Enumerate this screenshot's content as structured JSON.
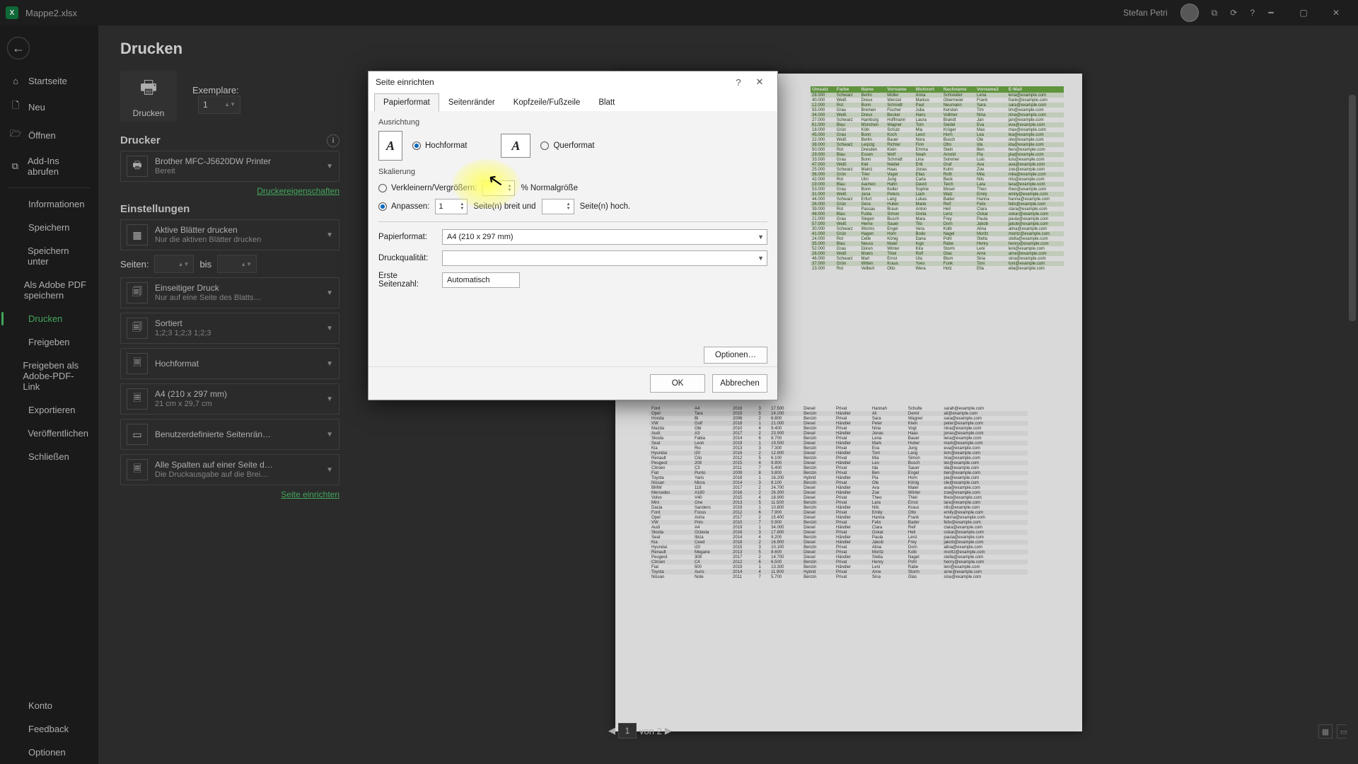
{
  "titlebar": {
    "filename": "Mappe2.xlsx",
    "username": "Stefan Petri"
  },
  "nav": {
    "items": [
      {
        "icon": "⌂",
        "label": "Startseite"
      },
      {
        "icon": "🗋",
        "label": "Neu"
      },
      {
        "icon": "🗁",
        "label": "Öffnen"
      },
      {
        "icon": "⧉",
        "label": "Add-Ins abrufen"
      },
      {
        "icon": "",
        "label": "Informationen"
      },
      {
        "icon": "",
        "label": "Speichern"
      },
      {
        "icon": "",
        "label": "Speichern unter"
      },
      {
        "icon": "",
        "label": "Als Adobe PDF speichern"
      },
      {
        "icon": "",
        "label": "Drucken",
        "active": true
      },
      {
        "icon": "",
        "label": "Freigeben"
      },
      {
        "icon": "",
        "label": "Freigeben als Adobe-PDF-Link"
      },
      {
        "icon": "",
        "label": "Exportieren"
      },
      {
        "icon": "",
        "label": "Veröffentlichen"
      },
      {
        "icon": "",
        "label": "Schließen"
      }
    ],
    "footer": [
      "Konto",
      "Feedback",
      "Optionen"
    ]
  },
  "print": {
    "title": "Drucken",
    "button_label": "Drucken",
    "copies_label": "Exemplare:",
    "copies_value": "1",
    "printer_heading": "Drucker",
    "printer_name": "Brother MFC-J5620DW Printer",
    "printer_status": "Bereit",
    "printer_props": "Druckereigenschaften",
    "settings_heading": "Einstellungen",
    "pages_label": "Seiten:",
    "pages_to": "bis",
    "page_setup_link": "Seite einrichten",
    "cards": [
      {
        "icon": "▦",
        "l1": "Aktive Blätter drucken",
        "l2": "Nur die aktiven Blätter drucken"
      },
      {
        "icon": "🗐",
        "l1": "Einseitiger Druck",
        "l2": "Nur auf eine Seite des Blatts…"
      },
      {
        "icon": "🗐",
        "l1": "Sortiert",
        "l2": "1;2;3   1;2;3   1;2;3"
      },
      {
        "icon": "🗏",
        "l1": "Hochformat",
        "l2": ""
      },
      {
        "icon": "🗏",
        "l1": "A4 (210 x 297 mm)",
        "l2": "21 cm x 29,7 cm"
      },
      {
        "icon": "▭",
        "l1": "Benutzerdefinierte Seitenrän…",
        "l2": ""
      },
      {
        "icon": "🗏",
        "l1": "Alle Spalten auf einer Seite d…",
        "l2": "Die Druckausgabe auf die Brei…"
      }
    ],
    "page_current": "1",
    "page_total": "von 2"
  },
  "dialog": {
    "title": "Seite einrichten",
    "tabs": [
      "Papierformat",
      "Seitenränder",
      "Kopfzeile/Fußzeile",
      "Blatt"
    ],
    "orientation_label": "Ausrichtung",
    "orient_portrait": "Hochformat",
    "orient_landscape": "Querformat",
    "scaling_label": "Skalierung",
    "scale_adjust": "Verkleinern/Vergrößern:",
    "scale_adjust_suffix": "% Normalgröße",
    "scale_fit": "Anpassen:",
    "scale_fit_wide_val": "1",
    "scale_fit_wide": "Seite(n) breit und",
    "scale_fit_tall": "Seite(n) hoch.",
    "paper_label": "Papierformat:",
    "paper_value": "A4 (210 x 297 mm)",
    "quality_label": "Druckqualität:",
    "quality_value": "",
    "firstpage_label": "Erste Seitenzahl:",
    "firstpage_value": "Automatisch",
    "options_btn": "Optionen…",
    "ok": "OK",
    "cancel": "Abbrechen"
  },
  "preview": {
    "headers": [
      "Umsatz",
      "Farbe",
      "Name",
      "Vorname",
      "Wohnort",
      "Nachname",
      "Vorname2",
      "E-Mail"
    ],
    "rows": [
      [
        "28.000",
        "Schwarz",
        "Berlin",
        "Müller",
        "Anna",
        "Schneider",
        "Lena",
        "lena@example.com"
      ],
      [
        "40.000",
        "Weiß",
        "Dreux",
        "Wenzel",
        "Markus",
        "Obermeier",
        "Frank",
        "frank@example.com"
      ],
      [
        "12.000",
        "Rot",
        "Bonn",
        "Schmidt",
        "Paul",
        "Neumann",
        "Sara",
        "sara@example.com"
      ],
      [
        "55.000",
        "Grau",
        "Bremen",
        "Fischer",
        "Julia",
        "Kersten",
        "Tim",
        "tim@example.com"
      ],
      [
        "34.000",
        "Weiß",
        "Dreux",
        "Becker",
        "Hans",
        "Vollmer",
        "Nina",
        "nina@example.com"
      ],
      [
        "27.000",
        "Schwarz",
        "Hamburg",
        "Hoffmann",
        "Laura",
        "Brandt",
        "Jan",
        "jan@example.com"
      ],
      [
        "61.000",
        "Blau",
        "München",
        "Wagner",
        "Tom",
        "Seidel",
        "Eva",
        "eva@example.com"
      ],
      [
        "18.000",
        "Grün",
        "Köln",
        "Schulz",
        "Mia",
        "Krüger",
        "Max",
        "max@example.com"
      ],
      [
        "45.000",
        "Grau",
        "Bonn",
        "Koch",
        "Leon",
        "Horn",
        "Lea",
        "lea@example.com"
      ],
      [
        "22.000",
        "Weiß",
        "Berlin",
        "Bauer",
        "Nora",
        "Busch",
        "Ole",
        "ole@example.com"
      ],
      [
        "38.000",
        "Schwarz",
        "Leipzig",
        "Richter",
        "Finn",
        "Otto",
        "Ida",
        "ida@example.com"
      ],
      [
        "50.000",
        "Rot",
        "Dresden",
        "Klein",
        "Emma",
        "Stein",
        "Ben",
        "ben@example.com"
      ],
      [
        "29.000",
        "Blau",
        "Essen",
        "Wolf",
        "Noah",
        "Arnold",
        "Pia",
        "pia@example.com"
      ],
      [
        "33.000",
        "Grau",
        "Bonn",
        "Schmidt",
        "Lina",
        "Sommer",
        "Luis",
        "luis@example.com"
      ],
      [
        "47.000",
        "Weiß",
        "Kiel",
        "Neider",
        "Erik",
        "Graf",
        "Ava",
        "ava@example.com"
      ],
      [
        "25.000",
        "Schwarz",
        "Mainz",
        "Haas",
        "Jonas",
        "Kuhn",
        "Zoe",
        "zoe@example.com"
      ],
      [
        "36.000",
        "Grün",
        "Trier",
        "Vogel",
        "Elias",
        "Roth",
        "Mila",
        "mila@example.com"
      ],
      [
        "42.000",
        "Rot",
        "Ulm",
        "Jung",
        "Carla",
        "Beck",
        "Nils",
        "nils@example.com"
      ],
      [
        "19.000",
        "Blau",
        "Aachen",
        "Hahn",
        "David",
        "Teich",
        "Lara",
        "lara@example.com"
      ],
      [
        "53.000",
        "Grau",
        "Bonn",
        "Keller",
        "Sophie",
        "Moser",
        "Theo",
        "theo@example.com"
      ],
      [
        "31.000",
        "Weiß",
        "Jena",
        "Peters",
        "Liam",
        "Walz",
        "Emily",
        "emily@example.com"
      ],
      [
        "44.000",
        "Schwarz",
        "Erfurt",
        "Lang",
        "Lukas",
        "Bader",
        "Hanna",
        "hanna@example.com"
      ],
      [
        "26.000",
        "Grün",
        "Gera",
        "Huber",
        "Marie",
        "Reif",
        "Felix",
        "felix@example.com"
      ],
      [
        "39.000",
        "Rot",
        "Passau",
        "Braun",
        "Anton",
        "Heil",
        "Clara",
        "clara@example.com"
      ],
      [
        "48.000",
        "Blau",
        "Fulda",
        "Simon",
        "Greta",
        "Lenz",
        "Oskar",
        "oskar@example.com"
      ],
      [
        "21.000",
        "Grau",
        "Siegen",
        "Busch",
        "Mara",
        "Frey",
        "Paula",
        "paula@example.com"
      ],
      [
        "57.000",
        "Weiß",
        "Herne",
        "Sauer",
        "Tilo",
        "Dorn",
        "Jakob",
        "jakob@example.com"
      ],
      [
        "30.000",
        "Schwarz",
        "Worms",
        "Engel",
        "Vera",
        "Kolb",
        "Alina",
        "alina@example.com"
      ],
      [
        "41.000",
        "Grün",
        "Hagen",
        "Horn",
        "Bodo",
        "Nagel",
        "Moritz",
        "moritz@example.com"
      ],
      [
        "24.000",
        "Rot",
        "Celle",
        "König",
        "Dana",
        "Pohl",
        "Stella",
        "stella@example.com"
      ],
      [
        "35.000",
        "Blau",
        "Neuss",
        "Maier",
        "Ingo",
        "Rabe",
        "Henry",
        "henry@example.com"
      ],
      [
        "52.000",
        "Grau",
        "Düren",
        "Winter",
        "Kira",
        "Storm",
        "Leni",
        "leni@example.com"
      ],
      [
        "28.000",
        "Weiß",
        "Moers",
        "Thiel",
        "Rolf",
        "Glas",
        "Arne",
        "arne@example.com"
      ],
      [
        "46.000",
        "Schwarz",
        "Marl",
        "Ernst",
        "Uta",
        "Blum",
        "Sina",
        "sina@example.com"
      ],
      [
        "37.000",
        "Grün",
        "Witten",
        "Kraus",
        "Yves",
        "Funk",
        "Toni",
        "toni@example.com"
      ],
      [
        "23.000",
        "Rot",
        "Velbert",
        "Otto",
        "Wera",
        "Holz",
        "Ella",
        "ella@example.com"
      ]
    ],
    "lower_rows": [
      [
        "Ford",
        "A4",
        "2016",
        "3",
        "17.500",
        "Diesel",
        "Privat",
        "Hannah",
        "Schulte",
        "sarah@example.com"
      ],
      [
        "Opel",
        "Tara",
        "2015",
        "5",
        "14.200",
        "Benzin",
        "Händler",
        "Ali",
        "Demir",
        "ali@example.com"
      ],
      [
        "Honda",
        "Bi",
        "2006",
        "2",
        "6.800",
        "Benzin",
        "Privat",
        "Sara",
        "Wagner",
        "sara@example.com"
      ],
      [
        "VW",
        "Golf",
        "2018",
        "1",
        "21.000",
        "Diesel",
        "Händler",
        "Peter",
        "Klein",
        "peter@example.com"
      ],
      [
        "Mazda",
        "Obi",
        "2010",
        "4",
        "9.400",
        "Benzin",
        "Privat",
        "Nina",
        "Vogt",
        "nina@example.com"
      ],
      [
        "Audi",
        "A3",
        "2017",
        "2",
        "23.900",
        "Diesel",
        "Händler",
        "Jonas",
        "Haas",
        "jonas@example.com"
      ],
      [
        "Skoda",
        "Fabia",
        "2014",
        "6",
        "8.700",
        "Benzin",
        "Privat",
        "Lena",
        "Bauer",
        "lena@example.com"
      ],
      [
        "Seat",
        "Leon",
        "2019",
        "1",
        "19.500",
        "Diesel",
        "Händler",
        "Mark",
        "Huber",
        "mark@example.com"
      ],
      [
        "Kia",
        "Rio",
        "2013",
        "3",
        "7.300",
        "Benzin",
        "Privat",
        "Eva",
        "Jung",
        "eva@example.com"
      ],
      [
        "Hyundai",
        "i30",
        "2016",
        "2",
        "12.800",
        "Diesel",
        "Händler",
        "Tom",
        "Lang",
        "tom@example.com"
      ],
      [
        "Renault",
        "Clio",
        "2012",
        "5",
        "6.100",
        "Benzin",
        "Privat",
        "Mia",
        "Simon",
        "mia@example.com"
      ],
      [
        "Peugeot",
        "208",
        "2015",
        "4",
        "9.900",
        "Diesel",
        "Händler",
        "Leo",
        "Busch",
        "leo@example.com"
      ],
      [
        "Citroen",
        "C3",
        "2011",
        "7",
        "5.400",
        "Benzin",
        "Privat",
        "Ida",
        "Sauer",
        "ida@example.com"
      ],
      [
        "Fiat",
        "Punto",
        "2009",
        "8",
        "3.800",
        "Benzin",
        "Privat",
        "Ben",
        "Engel",
        "ben@example.com"
      ],
      [
        "Toyota",
        "Yaris",
        "2018",
        "1",
        "16.200",
        "Hybrid",
        "Händler",
        "Pia",
        "Horn",
        "pia@example.com"
      ],
      [
        "Nissan",
        "Micra",
        "2014",
        "3",
        "8.100",
        "Benzin",
        "Privat",
        "Ole",
        "König",
        "ole@example.com"
      ],
      [
        "BMW",
        "118",
        "2017",
        "2",
        "24.700",
        "Diesel",
        "Händler",
        "Ava",
        "Maier",
        "ava@example.com"
      ],
      [
        "Mercedes",
        "A180",
        "2016",
        "2",
        "26.300",
        "Diesel",
        "Händler",
        "Zoe",
        "Winter",
        "zoe@example.com"
      ],
      [
        "Volvo",
        "V40",
        "2015",
        "4",
        "18.900",
        "Diesel",
        "Privat",
        "Theo",
        "Thiel",
        "theo@example.com"
      ],
      [
        "Mini",
        "One",
        "2013",
        "5",
        "11.500",
        "Benzin",
        "Privat",
        "Lara",
        "Ernst",
        "lara@example.com"
      ],
      [
        "Dacia",
        "Sandero",
        "2019",
        "1",
        "10.800",
        "Benzin",
        "Händler",
        "Nils",
        "Kraus",
        "nils@example.com"
      ],
      [
        "Ford",
        "Focus",
        "2012",
        "6",
        "7.900",
        "Diesel",
        "Privat",
        "Emily",
        "Otto",
        "emily@example.com"
      ],
      [
        "Opel",
        "Astra",
        "2017",
        "2",
        "15.400",
        "Diesel",
        "Händler",
        "Hanna",
        "Frank",
        "hanna@example.com"
      ],
      [
        "VW",
        "Polo",
        "2010",
        "7",
        "5.900",
        "Benzin",
        "Privat",
        "Felix",
        "Bader",
        "felix@example.com"
      ],
      [
        "Audi",
        "A4",
        "2019",
        "1",
        "34.000",
        "Diesel",
        "Händler",
        "Clara",
        "Reif",
        "clara@example.com"
      ],
      [
        "Skoda",
        "Octavia",
        "2016",
        "3",
        "17.800",
        "Diesel",
        "Privat",
        "Oskar",
        "Heil",
        "oskar@example.com"
      ],
      [
        "Seat",
        "Ibiza",
        "2014",
        "4",
        "9.200",
        "Benzin",
        "Händler",
        "Paula",
        "Lenz",
        "paula@example.com"
      ],
      [
        "Kia",
        "Ceed",
        "2018",
        "2",
        "16.900",
        "Diesel",
        "Händler",
        "Jakob",
        "Frey",
        "jakob@example.com"
      ],
      [
        "Hyundai",
        "i20",
        "2015",
        "3",
        "10.100",
        "Benzin",
        "Privat",
        "Alina",
        "Dorn",
        "alina@example.com"
      ],
      [
        "Renault",
        "Megane",
        "2013",
        "5",
        "8.600",
        "Diesel",
        "Privat",
        "Moritz",
        "Kolb",
        "moritz@example.com"
      ],
      [
        "Peugeot",
        "308",
        "2017",
        "2",
        "14.700",
        "Diesel",
        "Händler",
        "Stella",
        "Nagel",
        "stella@example.com"
      ],
      [
        "Citroen",
        "C4",
        "2012",
        "6",
        "6.500",
        "Benzin",
        "Privat",
        "Henry",
        "Pohl",
        "henry@example.com"
      ],
      [
        "Fiat",
        "500",
        "2019",
        "1",
        "13.300",
        "Benzin",
        "Händler",
        "Leni",
        "Rabe",
        "leni@example.com"
      ],
      [
        "Toyota",
        "Auris",
        "2014",
        "4",
        "11.900",
        "Hybrid",
        "Privat",
        "Arne",
        "Storm",
        "arne@example.com"
      ],
      [
        "Nissan",
        "Note",
        "2011",
        "7",
        "5.700",
        "Benzin",
        "Privat",
        "Sina",
        "Glas",
        "sina@example.com"
      ]
    ]
  }
}
